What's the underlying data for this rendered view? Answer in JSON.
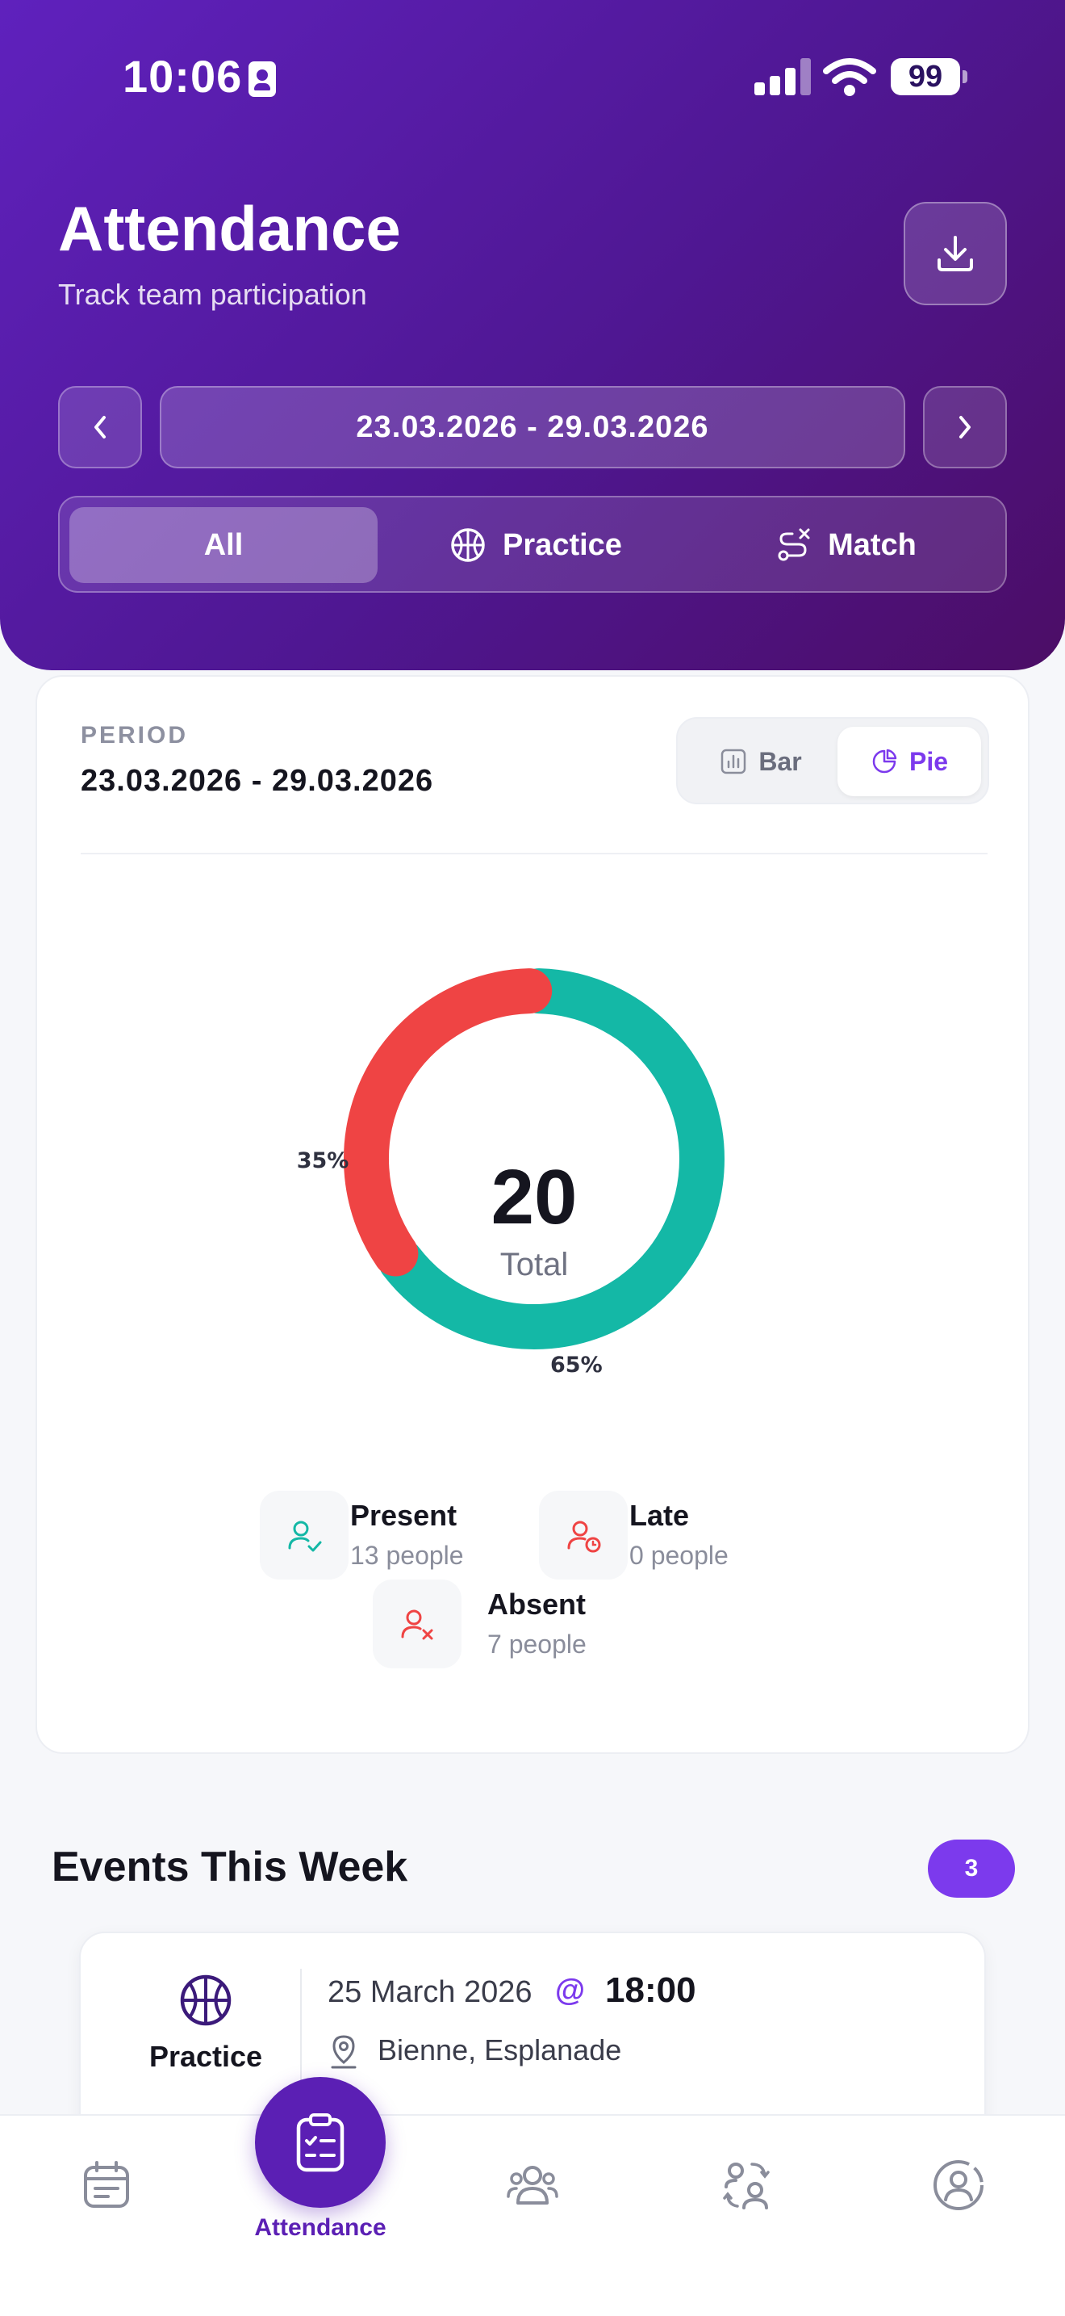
{
  "status_bar": {
    "time": "10:06",
    "battery": "99"
  },
  "header": {
    "title": "Attendance",
    "subtitle": "Track team participation",
    "date_range": "23.03.2026 - 29.03.2026",
    "filters": [
      {
        "label": "All",
        "active": true
      },
      {
        "label": "Practice",
        "icon": "basketball-icon"
      },
      {
        "label": "Match",
        "icon": "route-icon"
      }
    ]
  },
  "summary": {
    "period_label": "PERIOD",
    "period_value": "23.03.2026 - 29.03.2026",
    "toggle": {
      "bar": "Bar",
      "pie": "Pie",
      "selected": "Pie"
    },
    "total": "20",
    "total_label": "Total",
    "legend": [
      {
        "name": "Present",
        "count": "13 people",
        "color": "#14b8a6",
        "icon": "user-check-icon"
      },
      {
        "name": "Late",
        "count": "0 people",
        "color": "#ef4444",
        "icon": "user-clock-icon"
      },
      {
        "name": "Absent",
        "count": "7 people",
        "color": "#ef4444",
        "icon": "user-x-icon"
      }
    ]
  },
  "chart_data": {
    "type": "pie",
    "categories": [
      "Present",
      "Late",
      "Absent"
    ],
    "values": [
      13,
      0,
      7
    ],
    "percent_labels": [
      "65%",
      "",
      "35%"
    ],
    "colors": [
      "#14b8a6",
      "#f59e0b",
      "#ef4444"
    ],
    "center_value": "20",
    "center_label": "Total"
  },
  "events": {
    "title": "Events This Week",
    "count": "3",
    "items": [
      {
        "type": "Practice",
        "date": "25 March 2026",
        "at": "@",
        "time": "18:00",
        "location": "Bienne, Esplanade"
      }
    ]
  },
  "bottom_nav": {
    "active_label": "Attendance",
    "items": [
      "calendar-icon",
      "attendance-icon",
      "team-icon",
      "swap-user-icon",
      "profile-icon"
    ]
  },
  "colors": {
    "accent": "#7c3aed",
    "header_dark": "#4c0d66",
    "present": "#14b8a6",
    "absent": "#ef4444"
  }
}
